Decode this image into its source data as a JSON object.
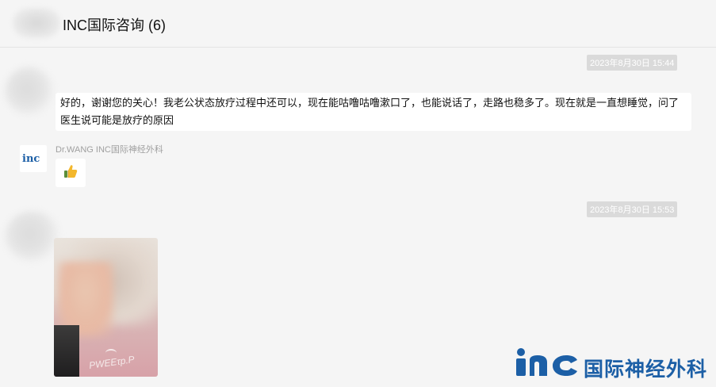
{
  "header": {
    "title": "INC国际咨询 (6)"
  },
  "messages": {
    "timestamp_1": "2023年8月30日 15:44",
    "text_message": "好的，谢谢您的关心！我老公状态放疗过程中还可以，现在能咕噜咕噜漱口了，也能说话了，走路也稳多了。现在就是一直想睡觉，问了医生说可能是放疗的原因",
    "sender_name": "Dr.WANG  INC国际神经外科",
    "avatar_logo_text": "inc",
    "emoji": "thumbs-up",
    "timestamp_2": "2023年8月30日 15:53",
    "image_shirt_text": "PWEEτp.P"
  },
  "watermark": {
    "logo_text": "inc",
    "text": "国际神经外科"
  },
  "colors": {
    "brand_blue": "#1c5fa6",
    "background": "#f5f5f5",
    "timestamp_bg": "#dadada",
    "bubble_bg": "#ffffff"
  }
}
